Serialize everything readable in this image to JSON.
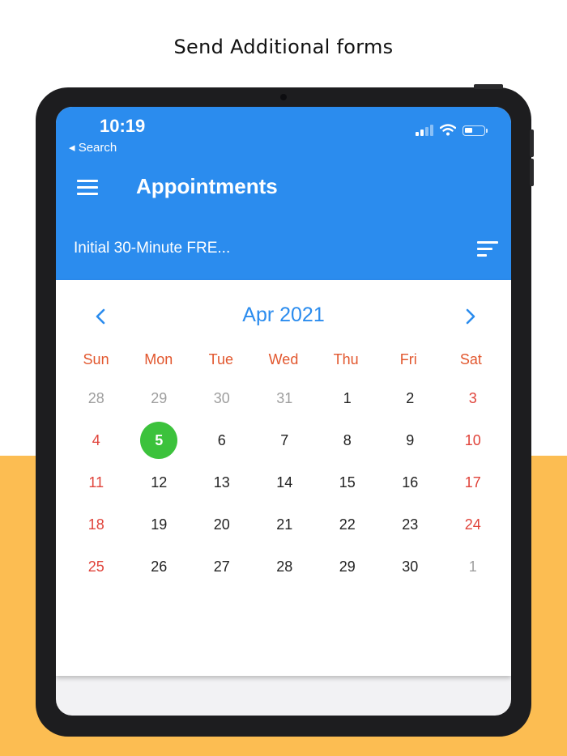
{
  "caption": "Send Additional forms",
  "status_bar": {
    "time": "10:19",
    "back_label": "◂ Search"
  },
  "app_bar": {
    "title": "Appointments",
    "subtitle": "Initial 30-Minute FRE..."
  },
  "calendar": {
    "month_label": "Apr 2021",
    "weekdays": [
      "Sun",
      "Mon",
      "Tue",
      "Wed",
      "Thu",
      "Fri",
      "Sat"
    ],
    "weeks": [
      [
        "28",
        "29",
        "30",
        "31",
        "1",
        "2",
        "3"
      ],
      [
        "4",
        "5",
        "6",
        "7",
        "8",
        "9",
        "10"
      ],
      [
        "11",
        "12",
        "13",
        "14",
        "15",
        "16",
        "17"
      ],
      [
        "18",
        "19",
        "20",
        "21",
        "22",
        "23",
        "24"
      ],
      [
        "25",
        "26",
        "27",
        "28",
        "29",
        "30",
        "1"
      ]
    ],
    "selected_day": "5"
  },
  "colors": {
    "brand_blue": "#2b8cee",
    "selected_green": "#3cc23c",
    "weekend_red": "#e0433a",
    "weekday_header": "#e2572e",
    "background_band": "#fcbd52"
  }
}
